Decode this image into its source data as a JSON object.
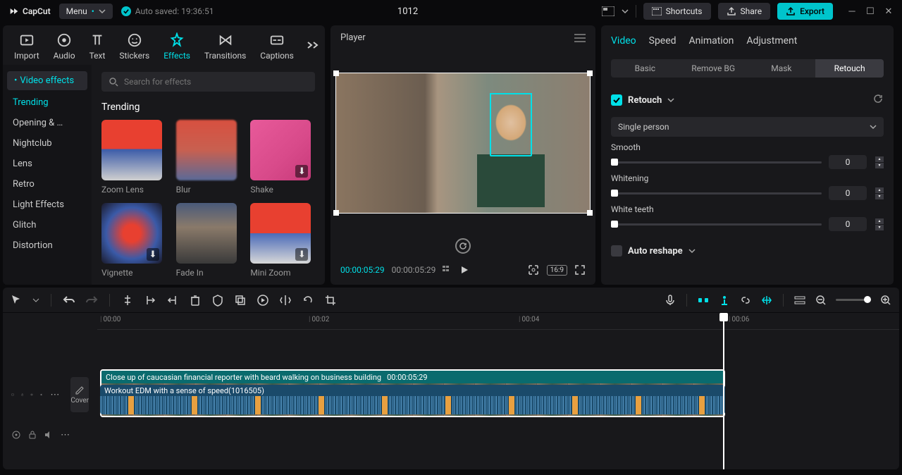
{
  "app": {
    "name": "CapCut",
    "menu": "Menu",
    "autosave": "Auto saved: 19:36:51",
    "project": "1012"
  },
  "titlebar": {
    "shortcuts": "Shortcuts",
    "share": "Share",
    "export": "Export"
  },
  "tabs": [
    "Import",
    "Audio",
    "Text",
    "Stickers",
    "Effects",
    "Transitions",
    "Captions"
  ],
  "effects": {
    "header": "Video effects",
    "cats": [
      "Trending",
      "Opening & …",
      "Nightclub",
      "Lens",
      "Retro",
      "Light Effects",
      "Glitch",
      "Distortion"
    ],
    "search_ph": "Search for effects",
    "section": "Trending",
    "items": [
      "Zoom Lens",
      "Blur",
      "Shake",
      "Vignette",
      "Fade In",
      "Mini Zoom"
    ]
  },
  "player": {
    "title": "Player",
    "cur": "00:00:05:29",
    "dur": "00:00:05:29",
    "ratio": "16:9"
  },
  "right": {
    "tabs": [
      "Video",
      "Speed",
      "Animation",
      "Adjustment"
    ],
    "subtabs": [
      "Basic",
      "Remove BG",
      "Mask",
      "Retouch"
    ],
    "retouch": "Retouch",
    "select": "Single person",
    "sliders": [
      {
        "label": "Smooth",
        "val": "0"
      },
      {
        "label": "Whitening",
        "val": "0"
      },
      {
        "label": "White teeth",
        "val": "0"
      }
    ],
    "auto": "Auto reshape"
  },
  "timeline": {
    "marks": [
      "00:00",
      "00:02",
      "00:04",
      "00:06"
    ],
    "clip_title": "Close up of caucasian financial reporter with beard walking on business building",
    "clip_dur": "00:00:05:29",
    "audio": "Workout EDM with a sense of speed(1016505)",
    "cover": "Cover"
  }
}
